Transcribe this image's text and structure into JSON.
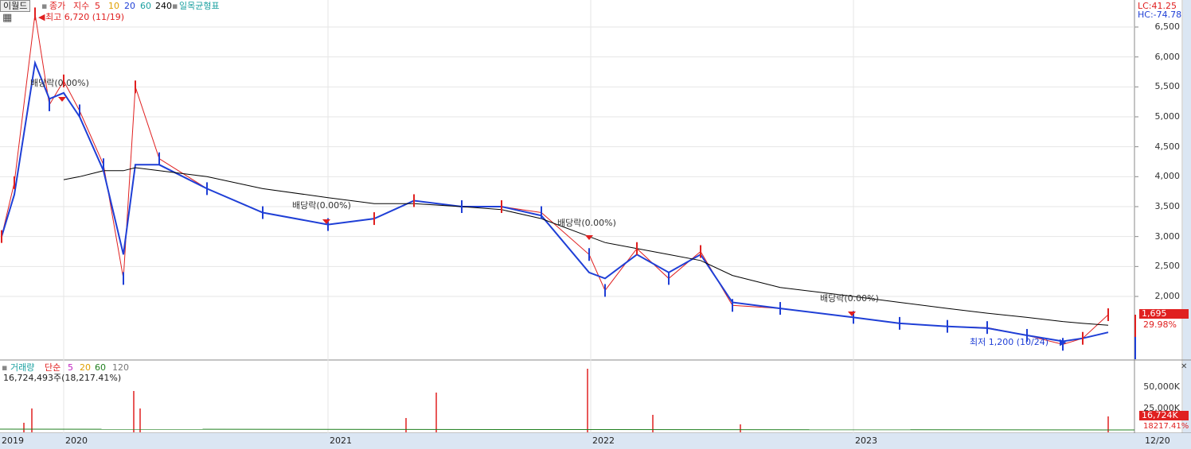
{
  "toolbar": {
    "period_button": "이월드",
    "price_label": "종가",
    "ma_label": "지수",
    "ma_periods": [
      "5",
      "10",
      "20",
      "60",
      "240"
    ],
    "ichimoku_label": "일목균형표"
  },
  "corner_stats": {
    "lc": "LC:41.25",
    "hc": "HC:-74.78"
  },
  "annotations": {
    "high": "최고 6,720 (11/19)",
    "low": "최저 1,200 (10/24)",
    "dividend": [
      "배당락(0.00%)",
      "배당락(0.00%)",
      "배당락(0.00%)",
      "배당락(0.00%)"
    ]
  },
  "price_tag": {
    "value": "1,695",
    "change": "29.98%"
  },
  "volume": {
    "title": "거래량",
    "ma_label": "단순",
    "ma_periods": [
      "5",
      "20",
      "60",
      "120"
    ],
    "last_value": "16,724,493주(18,217.41%)",
    "axis_labels": [
      "50,000K",
      "25,000K"
    ],
    "tag_value": "16,724K",
    "tag_pct": "18217.41%"
  },
  "x_axis": {
    "labels": [
      "2019",
      "2020",
      "2021",
      "2022",
      "2023"
    ],
    "last_date": "12/20"
  },
  "colors": {
    "up": "#e02020",
    "down": "#1f3fd6",
    "ma5": "#1f3fd6",
    "ma20": "#1aa0a0",
    "ma240": "#000000",
    "accent": "#e02020"
  },
  "chart_data": {
    "type": "line",
    "title": "이월드",
    "y_ticks": [
      2000,
      2500,
      3000,
      3500,
      4000,
      4500,
      5000,
      5500,
      6000,
      6500
    ],
    "y_tick_labels": [
      "2,000",
      "2,500",
      "3,000",
      "3,500",
      "4,000",
      "4,500",
      "5,000",
      "5,500",
      "6,000",
      "6,500"
    ],
    "ylim": [
      1000,
      6700
    ],
    "x": [
      "2019-10",
      "2019-11",
      "2019-11-19",
      "2019-12",
      "2020-01",
      "2020-02",
      "2020-03",
      "2020-04",
      "2020-05",
      "2020-06",
      "2020-08",
      "2020-10",
      "2020-12",
      "2021-02",
      "2021-04",
      "2021-06",
      "2021-08",
      "2021-10",
      "2021-12",
      "2022-01",
      "2022-03",
      "2022-05",
      "2022-07",
      "2022-09",
      "2022-11",
      "2023-01",
      "2023-03",
      "2023-05",
      "2023-07",
      "2023-09",
      "2023-10-24",
      "2023-11",
      "2023-12-20"
    ],
    "series": [
      {
        "name": "종가",
        "values": [
          3000,
          3900,
          6720,
          5200,
          5600,
          5100,
          4200,
          2300,
          5500,
          4300,
          3800,
          3400,
          3200,
          3300,
          3600,
          3500,
          3500,
          3400,
          2700,
          2100,
          2800,
          2300,
          2750,
          1850,
          1800,
          1650,
          1550,
          1500,
          1480,
          1350,
          1200,
          1300,
          1695
        ]
      },
      {
        "name": "5",
        "values": [
          3000,
          3700,
          5900,
          5300,
          5400,
          5000,
          4100,
          2700,
          4200,
          4200,
          3800,
          3400,
          3200,
          3300,
          3600,
          3500,
          3500,
          3350,
          2400,
          2300,
          2700,
          2400,
          2700,
          1900,
          1800,
          1650,
          1550,
          1500,
          1470,
          1350,
          1250,
          1300,
          1400
        ]
      },
      {
        "name": "240",
        "values": [
          null,
          null,
          null,
          null,
          3950,
          4000,
          4100,
          4100,
          4150,
          4100,
          4000,
          3800,
          3650,
          3550,
          3550,
          3500,
          3450,
          3300,
          3000,
          2900,
          2800,
          2700,
          2600,
          2350,
          2150,
          2000,
          1900,
          1800,
          1720,
          1650,
          1580,
          1550,
          1520
        ]
      }
    ]
  }
}
